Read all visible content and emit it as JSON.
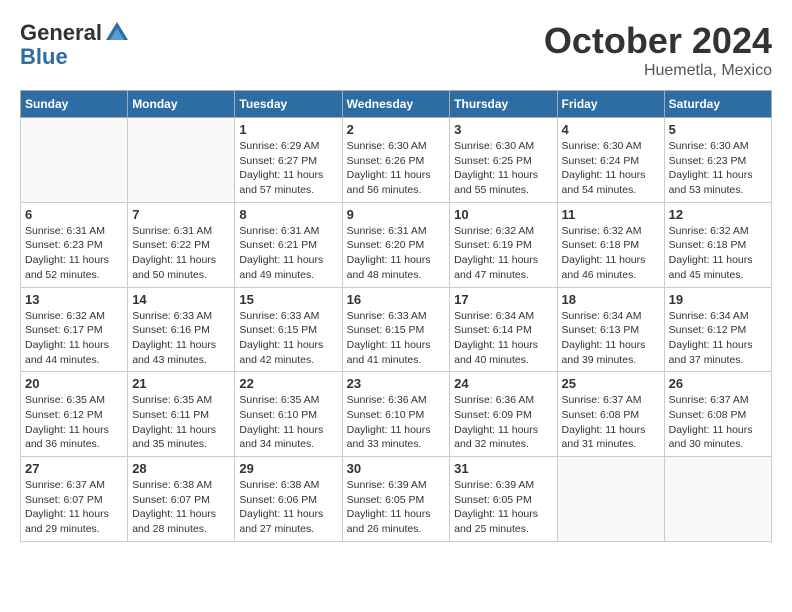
{
  "logo": {
    "general": "General",
    "blue": "Blue"
  },
  "title": "October 2024",
  "location": "Huemetla, Mexico",
  "days_of_week": [
    "Sunday",
    "Monday",
    "Tuesday",
    "Wednesday",
    "Thursday",
    "Friday",
    "Saturday"
  ],
  "weeks": [
    [
      {
        "day": "",
        "sunrise": "",
        "sunset": "",
        "daylight": ""
      },
      {
        "day": "",
        "sunrise": "",
        "sunset": "",
        "daylight": ""
      },
      {
        "day": "1",
        "sunrise": "Sunrise: 6:29 AM",
        "sunset": "Sunset: 6:27 PM",
        "daylight": "Daylight: 11 hours and 57 minutes."
      },
      {
        "day": "2",
        "sunrise": "Sunrise: 6:30 AM",
        "sunset": "Sunset: 6:26 PM",
        "daylight": "Daylight: 11 hours and 56 minutes."
      },
      {
        "day": "3",
        "sunrise": "Sunrise: 6:30 AM",
        "sunset": "Sunset: 6:25 PM",
        "daylight": "Daylight: 11 hours and 55 minutes."
      },
      {
        "day": "4",
        "sunrise": "Sunrise: 6:30 AM",
        "sunset": "Sunset: 6:24 PM",
        "daylight": "Daylight: 11 hours and 54 minutes."
      },
      {
        "day": "5",
        "sunrise": "Sunrise: 6:30 AM",
        "sunset": "Sunset: 6:23 PM",
        "daylight": "Daylight: 11 hours and 53 minutes."
      }
    ],
    [
      {
        "day": "6",
        "sunrise": "Sunrise: 6:31 AM",
        "sunset": "Sunset: 6:23 PM",
        "daylight": "Daylight: 11 hours and 52 minutes."
      },
      {
        "day": "7",
        "sunrise": "Sunrise: 6:31 AM",
        "sunset": "Sunset: 6:22 PM",
        "daylight": "Daylight: 11 hours and 50 minutes."
      },
      {
        "day": "8",
        "sunrise": "Sunrise: 6:31 AM",
        "sunset": "Sunset: 6:21 PM",
        "daylight": "Daylight: 11 hours and 49 minutes."
      },
      {
        "day": "9",
        "sunrise": "Sunrise: 6:31 AM",
        "sunset": "Sunset: 6:20 PM",
        "daylight": "Daylight: 11 hours and 48 minutes."
      },
      {
        "day": "10",
        "sunrise": "Sunrise: 6:32 AM",
        "sunset": "Sunset: 6:19 PM",
        "daylight": "Daylight: 11 hours and 47 minutes."
      },
      {
        "day": "11",
        "sunrise": "Sunrise: 6:32 AM",
        "sunset": "Sunset: 6:18 PM",
        "daylight": "Daylight: 11 hours and 46 minutes."
      },
      {
        "day": "12",
        "sunrise": "Sunrise: 6:32 AM",
        "sunset": "Sunset: 6:18 PM",
        "daylight": "Daylight: 11 hours and 45 minutes."
      }
    ],
    [
      {
        "day": "13",
        "sunrise": "Sunrise: 6:32 AM",
        "sunset": "Sunset: 6:17 PM",
        "daylight": "Daylight: 11 hours and 44 minutes."
      },
      {
        "day": "14",
        "sunrise": "Sunrise: 6:33 AM",
        "sunset": "Sunset: 6:16 PM",
        "daylight": "Daylight: 11 hours and 43 minutes."
      },
      {
        "day": "15",
        "sunrise": "Sunrise: 6:33 AM",
        "sunset": "Sunset: 6:15 PM",
        "daylight": "Daylight: 11 hours and 42 minutes."
      },
      {
        "day": "16",
        "sunrise": "Sunrise: 6:33 AM",
        "sunset": "Sunset: 6:15 PM",
        "daylight": "Daylight: 11 hours and 41 minutes."
      },
      {
        "day": "17",
        "sunrise": "Sunrise: 6:34 AM",
        "sunset": "Sunset: 6:14 PM",
        "daylight": "Daylight: 11 hours and 40 minutes."
      },
      {
        "day": "18",
        "sunrise": "Sunrise: 6:34 AM",
        "sunset": "Sunset: 6:13 PM",
        "daylight": "Daylight: 11 hours and 39 minutes."
      },
      {
        "day": "19",
        "sunrise": "Sunrise: 6:34 AM",
        "sunset": "Sunset: 6:12 PM",
        "daylight": "Daylight: 11 hours and 37 minutes."
      }
    ],
    [
      {
        "day": "20",
        "sunrise": "Sunrise: 6:35 AM",
        "sunset": "Sunset: 6:12 PM",
        "daylight": "Daylight: 11 hours and 36 minutes."
      },
      {
        "day": "21",
        "sunrise": "Sunrise: 6:35 AM",
        "sunset": "Sunset: 6:11 PM",
        "daylight": "Daylight: 11 hours and 35 minutes."
      },
      {
        "day": "22",
        "sunrise": "Sunrise: 6:35 AM",
        "sunset": "Sunset: 6:10 PM",
        "daylight": "Daylight: 11 hours and 34 minutes."
      },
      {
        "day": "23",
        "sunrise": "Sunrise: 6:36 AM",
        "sunset": "Sunset: 6:10 PM",
        "daylight": "Daylight: 11 hours and 33 minutes."
      },
      {
        "day": "24",
        "sunrise": "Sunrise: 6:36 AM",
        "sunset": "Sunset: 6:09 PM",
        "daylight": "Daylight: 11 hours and 32 minutes."
      },
      {
        "day": "25",
        "sunrise": "Sunrise: 6:37 AM",
        "sunset": "Sunset: 6:08 PM",
        "daylight": "Daylight: 11 hours and 31 minutes."
      },
      {
        "day": "26",
        "sunrise": "Sunrise: 6:37 AM",
        "sunset": "Sunset: 6:08 PM",
        "daylight": "Daylight: 11 hours and 30 minutes."
      }
    ],
    [
      {
        "day": "27",
        "sunrise": "Sunrise: 6:37 AM",
        "sunset": "Sunset: 6:07 PM",
        "daylight": "Daylight: 11 hours and 29 minutes."
      },
      {
        "day": "28",
        "sunrise": "Sunrise: 6:38 AM",
        "sunset": "Sunset: 6:07 PM",
        "daylight": "Daylight: 11 hours and 28 minutes."
      },
      {
        "day": "29",
        "sunrise": "Sunrise: 6:38 AM",
        "sunset": "Sunset: 6:06 PM",
        "daylight": "Daylight: 11 hours and 27 minutes."
      },
      {
        "day": "30",
        "sunrise": "Sunrise: 6:39 AM",
        "sunset": "Sunset: 6:05 PM",
        "daylight": "Daylight: 11 hours and 26 minutes."
      },
      {
        "day": "31",
        "sunrise": "Sunrise: 6:39 AM",
        "sunset": "Sunset: 6:05 PM",
        "daylight": "Daylight: 11 hours and 25 minutes."
      },
      {
        "day": "",
        "sunrise": "",
        "sunset": "",
        "daylight": ""
      },
      {
        "day": "",
        "sunrise": "",
        "sunset": "",
        "daylight": ""
      }
    ]
  ]
}
